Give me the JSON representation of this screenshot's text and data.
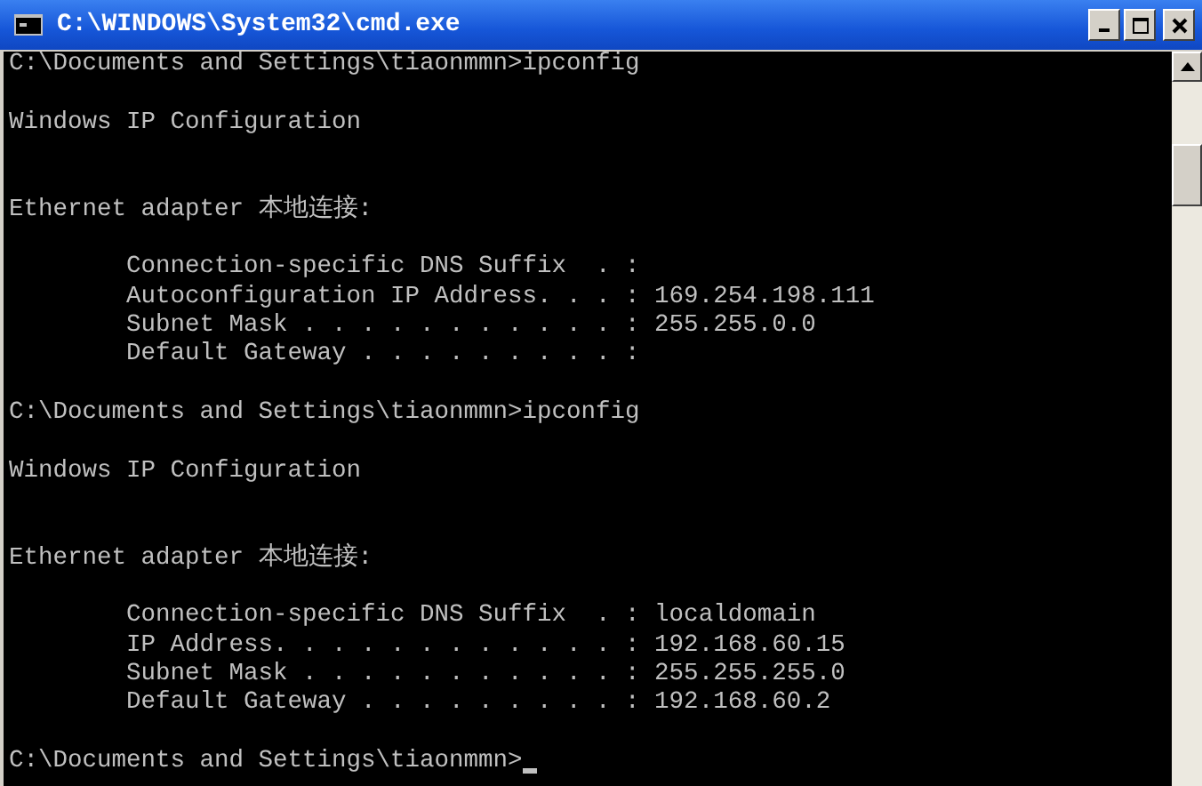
{
  "window": {
    "title": "C:\\WINDOWS\\System32\\cmd.exe"
  },
  "console": {
    "lines": [
      {
        "kind": "text",
        "text": "C:\\Documents and Settings\\tiaonmmn>ipconfig"
      },
      {
        "kind": "blank"
      },
      {
        "kind": "text",
        "text": "Windows IP Configuration"
      },
      {
        "kind": "blank"
      },
      {
        "kind": "blank"
      },
      {
        "kind": "text",
        "text": "Ethernet adapter 本地连接:"
      },
      {
        "kind": "blank"
      },
      {
        "kind": "text",
        "text": "        Connection-specific DNS Suffix  . :"
      },
      {
        "kind": "text",
        "text": "        Autoconfiguration IP Address. . . : 169.254.198.111"
      },
      {
        "kind": "text",
        "text": "        Subnet Mask . . . . . . . . . . . : 255.255.0.0"
      },
      {
        "kind": "text",
        "text": "        Default Gateway . . . . . . . . . :"
      },
      {
        "kind": "blank"
      },
      {
        "kind": "text",
        "text": "C:\\Documents and Settings\\tiaonmmn>ipconfig"
      },
      {
        "kind": "blank"
      },
      {
        "kind": "text",
        "text": "Windows IP Configuration"
      },
      {
        "kind": "blank"
      },
      {
        "kind": "blank"
      },
      {
        "kind": "text",
        "text": "Ethernet adapter 本地连接:"
      },
      {
        "kind": "blank"
      },
      {
        "kind": "text",
        "text": "        Connection-specific DNS Suffix  . : localdomain"
      },
      {
        "kind": "text",
        "text": "        IP Address. . . . . . . . . . . . : 192.168.60.15"
      },
      {
        "kind": "text",
        "text": "        Subnet Mask . . . . . . . . . . . : 255.255.255.0"
      },
      {
        "kind": "text",
        "text": "        Default Gateway . . . . . . . . . : 192.168.60.2"
      },
      {
        "kind": "blank"
      },
      {
        "kind": "text",
        "text": "C:\\Documents and Settings\\tiaonmmn>",
        "cursor": true
      }
    ]
  }
}
